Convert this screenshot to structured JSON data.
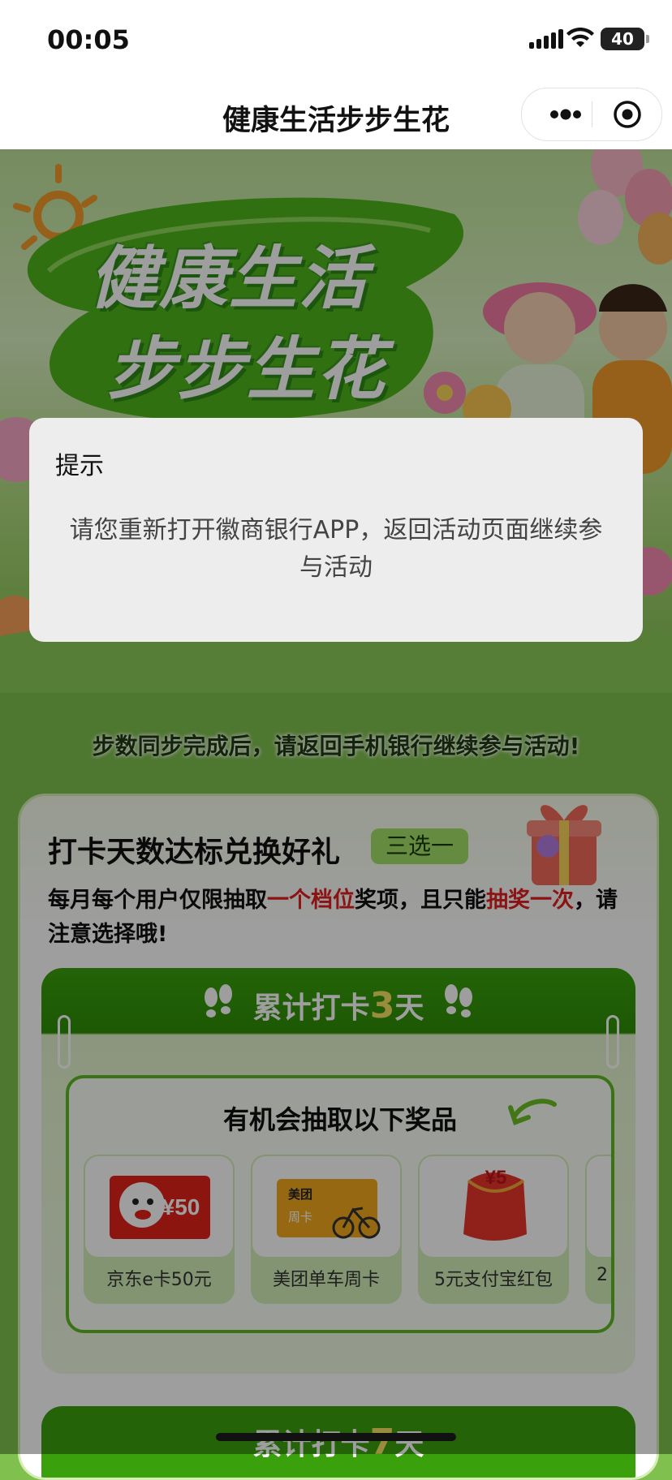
{
  "status_bar": {
    "time": "00:05",
    "battery": "40"
  },
  "navbar": {
    "title": "健康生活步步生花",
    "more_icon": "more-dots-icon",
    "close_icon": "target-circle-icon"
  },
  "hero": {
    "line1": "健康生活",
    "line2": "步步生花"
  },
  "sync_note": "步数同步完成后，请返回手机银行继续参与活动!",
  "card": {
    "title": "打卡天数达标兑换好礼",
    "badge": "三选一",
    "rules_part1": "每月每个用户仅限抽取",
    "rules_hl1": "一个档位",
    "rules_part2": "奖项，且只能",
    "rules_hl2": "抽奖一次",
    "rules_part3": "，请注意选择哦!",
    "tier1": {
      "title_pre": "累计打卡",
      "days": "3",
      "title_post": "天",
      "inner_title": "有机会抽取以下奖品",
      "prizes": [
        {
          "label": "京东e卡50元",
          "price": "¥50",
          "icon": "jd-card-icon"
        },
        {
          "label": "美团单车周卡",
          "card_top": "美团",
          "card_bottom": "周卡",
          "icon": "meituan-bike-card-icon"
        },
        {
          "label": "5元支付宝红包",
          "price": "¥5",
          "icon": "red-envelope-icon"
        },
        {
          "label": "2",
          "icon": "partial-prize-icon"
        }
      ]
    },
    "tier2": {
      "title_pre": "累计打卡",
      "days": "7",
      "title_post": "天"
    }
  },
  "modal": {
    "title": "提示",
    "message": "请您重新打开徽商银行APP，返回活动页面继续参与活动"
  },
  "colors": {
    "primary_green": "#3aa10d",
    "highlight_red": "#e02020",
    "accent_yellow": "#f7e463"
  }
}
